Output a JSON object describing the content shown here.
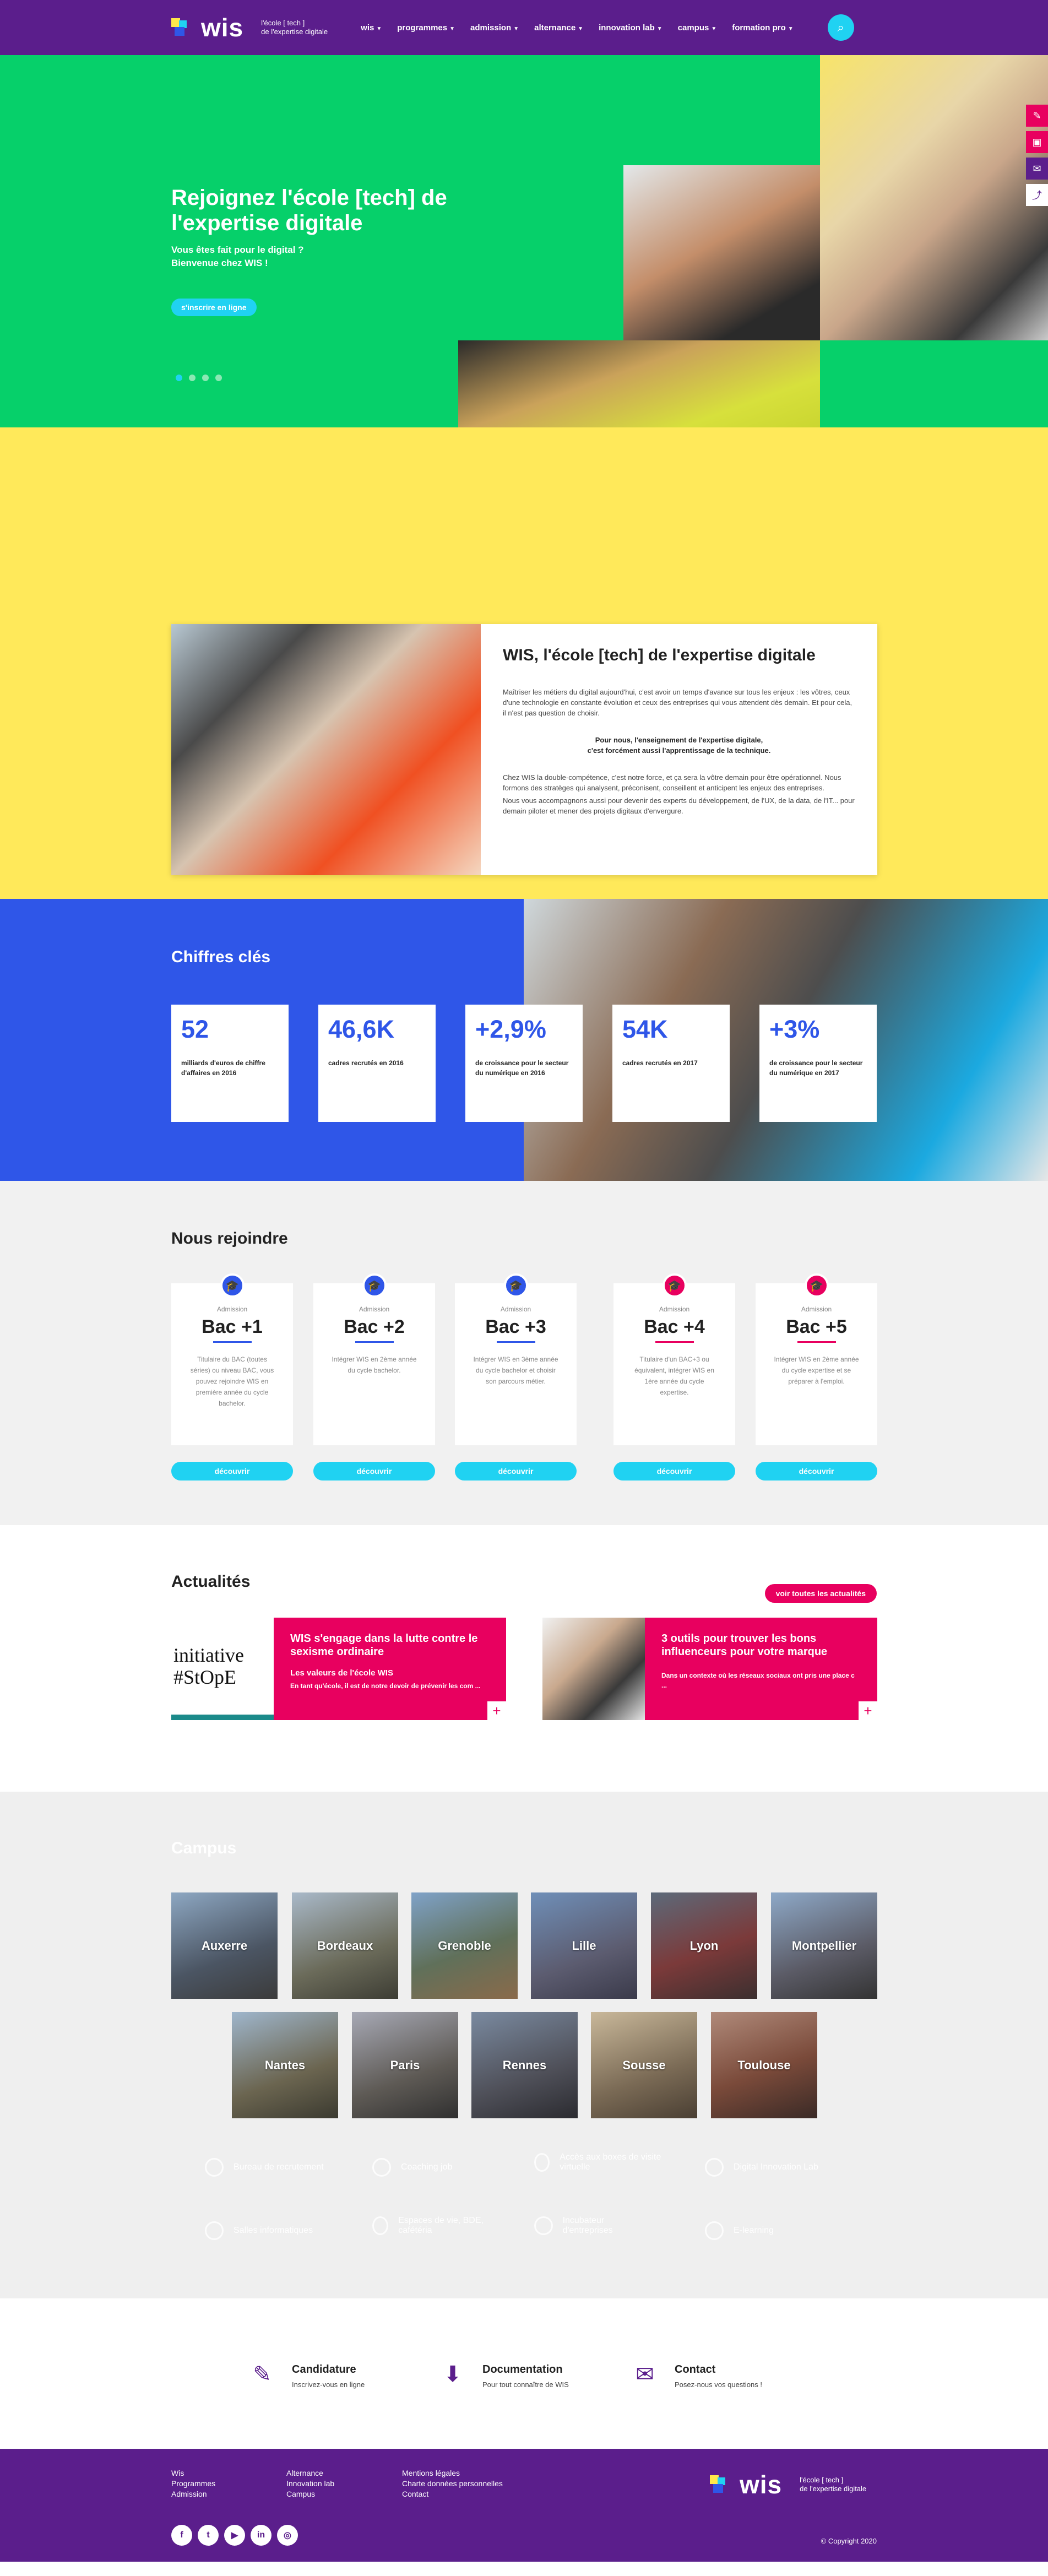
{
  "nav": {
    "logo_word": "wis",
    "tagline_1": "l'école [ tech ]",
    "tagline_2": "de l'expertise digitale",
    "items": [
      "wis",
      "programmes",
      "admission",
      "alternance",
      "innovation lab",
      "campus",
      "formation pro"
    ],
    "search_icon": "⌕"
  },
  "hero": {
    "title": "Rejoignez l'école [tech] de l'expertise digitale",
    "sub_1": "Vous êtes fait pour le digital ?",
    "sub_2": "Bienvenue chez WIS !",
    "cta": "s'inscrire en ligne"
  },
  "about": {
    "title": "WIS, l'école [tech] de l'expertise digitale",
    "p1": "Maîtriser les métiers du digital aujourd'hui, c'est avoir un temps d'avance sur tous les enjeux : les vôtres, ceux d'une technologie en constante évolution et ceux des entreprises qui vous attendent dès demain. Et pour cela, il n'est pas question de choisir.",
    "p2a": "Pour nous, l'enseignement de l'expertise digitale,",
    "p2b": "c'est forcément aussi l'apprentissage de la technique.",
    "p3": "Chez WIS la double-compétence, c'est notre force, et ça sera la vôtre demain pour être opérationnel. Nous formons des stratèges qui analysent, préconisent, conseillent et anticipent les enjeux des entreprises.",
    "p4": "Nous vous accompagnons aussi pour devenir des experts du développement, de l'UX, de la data, de l'IT... pour demain piloter et mener des projets digitaux d'envergure."
  },
  "figures": {
    "title": "Chiffres clés",
    "items": [
      {
        "value": "52",
        "label": "milliards d'euros de chiffre d'affaires en 2016"
      },
      {
        "value": "46,6K",
        "label": "cadres recrutés en 2016"
      },
      {
        "value": "+2,9%",
        "label": "de croissance pour le secteur du numérique en 2016"
      },
      {
        "value": "54K",
        "label": "cadres recrutés en 2017"
      },
      {
        "value": "+3%",
        "label": "de croissance pour le secteur du numérique en 2017"
      }
    ]
  },
  "join": {
    "title": "Nous rejoindre",
    "items": [
      {
        "adm": "Admission",
        "level": "Bac +1",
        "desc": "Titulaire du BAC (toutes séries) ou niveau BAC, vous pouvez rejoindre WIS en première année du cycle bachelor.",
        "btn": "découvrir",
        "icon": "🎓"
      },
      {
        "adm": "Admission",
        "level": "Bac +2",
        "desc": "Intégrer WIS en 2ème année du cycle bachelor.",
        "btn": "découvrir",
        "icon": "🎓"
      },
      {
        "adm": "Admission",
        "level": "Bac +3",
        "desc": "Intégrer WIS en 3ème année du cycle bachelor et choisir son parcours métier.",
        "btn": "découvrir",
        "icon": "🎓"
      },
      {
        "adm": "Admission",
        "level": "Bac +4",
        "desc": "Titulaire d'un BAC+3 ou équivalent, intégrer WIS en 1ère année du cycle expertise.",
        "btn": "découvrir",
        "icon": "🎓"
      },
      {
        "adm": "Admission",
        "level": "Bac +5",
        "desc": "Intégrer WIS en 2ème année du cycle expertise et se préparer à l'emploi.",
        "btn": "découvrir",
        "icon": "🎓"
      }
    ]
  },
  "news": {
    "title": "Actualités",
    "all": "voir toutes les actualités",
    "items": [
      {
        "title": "WIS s'engage dans la lutte contre le sexisme ordinaire",
        "sub": "Les valeurs de l'école WIS",
        "text": "En tant qu'école, il est de notre devoir de prévenir les com ...",
        "img_text": "initiative #StOpE",
        "plus": "+"
      },
      {
        "title": "3 outils pour trouver les bons influenceurs pour votre marque",
        "sub": "",
        "text": "Dans un contexte où les réseaux sociaux ont pris une place c ...",
        "img_text": "",
        "plus": "+"
      }
    ]
  },
  "campus": {
    "title": "Campus",
    "cities": [
      "Auxerre",
      "Bordeaux",
      "Grenoble",
      "Lille",
      "Lyon",
      "Montpellier",
      "Nantes",
      "Paris",
      "Rennes",
      "Sousse",
      "Toulouse"
    ],
    "features": [
      "Bureau de recrutement",
      "Coaching job",
      "Accès aux boxes de visite virtuelle",
      "Digital Innovation Lab",
      "Salles informatiques",
      "Espaces de vie, BDE, cafétéria",
      "Incubateur d'entreprises",
      "E-learning"
    ]
  },
  "cta": [
    {
      "title": "Candidature",
      "sub": "Inscrivez-vous en ligne",
      "icon": "✎"
    },
    {
      "title": "Documentation",
      "sub": "Pour tout connaître de WIS",
      "icon": "⬇"
    },
    {
      "title": "Contact",
      "sub": "Posez-nous vos questions !",
      "icon": "✉"
    }
  ],
  "footer": {
    "col1": [
      "Wis",
      "Programmes",
      "Admission"
    ],
    "col2": [
      "Alternance",
      "Innovation lab",
      "Campus"
    ],
    "col3": [
      "Mentions légales",
      "Charte données personnelles",
      "Contact"
    ],
    "socials": [
      "f",
      "t",
      "▶",
      "in",
      "◎"
    ],
    "logo_word": "wis",
    "tagline_1": "l'école [ tech ]",
    "tagline_2": "de l'expertise digitale",
    "copyright": "© Copyright 2020"
  },
  "rail": [
    "✎",
    "▣",
    "✉",
    "⤴"
  ]
}
